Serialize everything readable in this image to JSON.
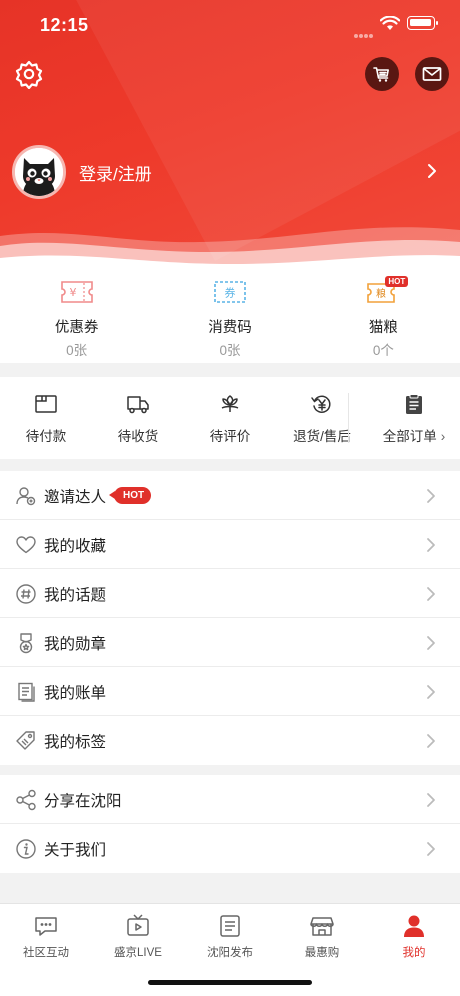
{
  "status_bar": {
    "time": "12:15"
  },
  "header": {
    "login_label": "登录/注册",
    "accent_color": "#e63327",
    "icons": [
      "settings-icon",
      "cart-icon",
      "mail-icon",
      "avatar-cat",
      "chevron-right-icon"
    ]
  },
  "coupons": [
    {
      "label": "优惠券",
      "count": "0张",
      "icon": "ticket-icon",
      "glyph": "¥"
    },
    {
      "label": "消费码",
      "count": "0张",
      "icon": "voucher-icon",
      "glyph": "券"
    },
    {
      "label": "猫粮",
      "count": "0个",
      "icon": "cat-food-icon",
      "glyph": "粮",
      "badge": "HOT"
    }
  ],
  "orders": [
    {
      "label": "待付款",
      "icon": "wallet-icon"
    },
    {
      "label": "待收货",
      "icon": "truck-icon"
    },
    {
      "label": "待评价",
      "icon": "flower-icon"
    },
    {
      "label": "退货/售后",
      "icon": "refund-icon"
    },
    {
      "label": "全部订单",
      "icon": "clipboard-icon",
      "chevron": "›"
    }
  ],
  "menu_list_1": [
    {
      "label": "邀请达人",
      "icon": "invite-user-icon",
      "badge": "HOT"
    },
    {
      "label": "我的收藏",
      "icon": "heart-icon"
    },
    {
      "label": "我的话题",
      "icon": "hashtag-icon"
    },
    {
      "label": "我的勋章",
      "icon": "medal-icon"
    },
    {
      "label": "我的账单",
      "icon": "bill-icon"
    },
    {
      "label": "我的标签",
      "icon": "tag-icon"
    }
  ],
  "menu_list_2": [
    {
      "label": "分享在沈阳",
      "icon": "share-icon"
    },
    {
      "label": "关于我们",
      "icon": "info-icon"
    }
  ],
  "tabbar": [
    {
      "label": "社区互动",
      "icon": "chat-icon",
      "active": false
    },
    {
      "label": "盛京LIVE",
      "icon": "tv-icon",
      "active": false
    },
    {
      "label": "沈阳发布",
      "icon": "news-icon",
      "active": false
    },
    {
      "label": "最惠购",
      "icon": "shop-icon",
      "active": false
    },
    {
      "label": "我的",
      "icon": "user-icon",
      "active": true
    }
  ],
  "colors": {
    "active_tab": "#e0302a",
    "hot_badge": "#e0302a"
  }
}
